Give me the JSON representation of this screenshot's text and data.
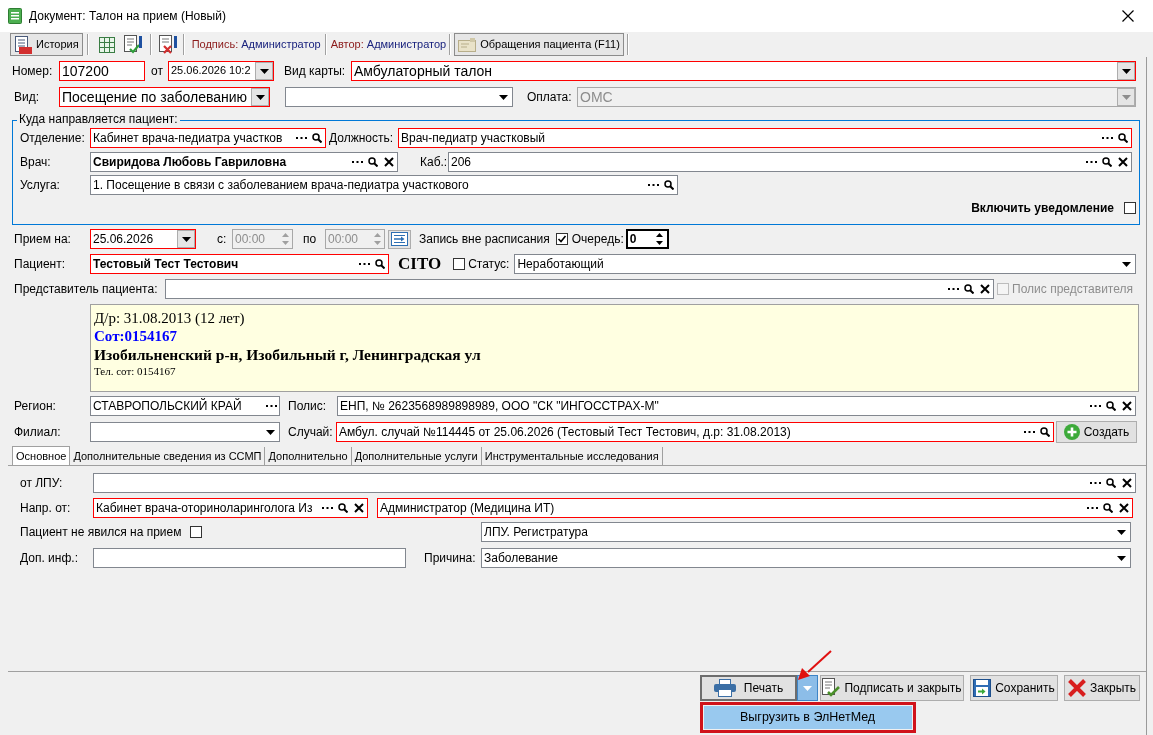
{
  "window": {
    "title": "Документ: Талон на прием (Новый)"
  },
  "toolbar": {
    "history_button": "История",
    "signed_by": {
      "label": "Подпись:",
      "value": "Администратор"
    },
    "author": {
      "label": "Автор:",
      "value": "Администратор"
    },
    "patient_appeals_button": "Обращения пациента (F11)"
  },
  "header": {
    "number": {
      "label": "Номер:",
      "value": "107200",
      "required": true
    },
    "date": {
      "label": "от",
      "value": "25.06.2026 10:2",
      "required": true
    },
    "card_type": {
      "label": "Вид карты:",
      "value": "Амбулаторный талон",
      "required": true
    },
    "visit_type": {
      "label": "Вид:",
      "value": "Посещение по заболеванию",
      "required": true
    },
    "visit_subtype": {
      "required": false
    },
    "payment": {
      "label": "Оплата:",
      "value": "ОМС",
      "disabled": true
    }
  },
  "referral": {
    "title": "Куда направляется пациент:",
    "department": {
      "label": "Отделение:",
      "value": "Кабинет врача-педиатра участков",
      "required": true
    },
    "position": {
      "label": "Должность:",
      "value": "Врач-педиатр участковый",
      "required": true
    },
    "doctor": {
      "label": "Врач:",
      "value": "Свиридова Любовь Гавриловна",
      "required": false
    },
    "room": {
      "label": "Каб.:",
      "value": "206",
      "required": false
    },
    "service": {
      "label": "Услуга:",
      "value": "1. Посещение в связи с заболеванием врача-педиатра участкового",
      "required": false
    },
    "notification": {
      "label": "Включить уведомление",
      "checked": false
    }
  },
  "appointment": {
    "date": {
      "label": "Прием на:",
      "value": "25.06.2026",
      "required": true
    },
    "time_from": {
      "label": "с:",
      "value": "00:00",
      "disabled": true
    },
    "time_to": {
      "label": "по",
      "value": "00:00",
      "disabled": true
    },
    "off_schedule": {
      "label": "Запись вне расписания",
      "checked": true
    },
    "queue": {
      "label": "Очередь:",
      "value": "0",
      "focused": true
    }
  },
  "patient": {
    "name": {
      "label": "Пациент:",
      "value": "Тестовый Тест Тестович",
      "required": true
    },
    "cito": {
      "label": "CITO",
      "checked": false
    },
    "status": {
      "label": "Статус:",
      "value": "Неработающий",
      "required": false
    },
    "representative": {
      "label": "Представитель пациента:",
      "required": false
    },
    "representative_policy": {
      "label": "Полис представителя",
      "checked": false,
      "disabled": true
    },
    "info": [
      {
        "kind": "birth",
        "text": "Д/р: 31.08.2013 (12 лет)"
      },
      {
        "kind": "contact",
        "text": "Сот:0154167"
      },
      {
        "kind": "address",
        "text": "Изобильненский р-н, Изобильный г, Ленинградская ул"
      },
      {
        "kind": "note",
        "text": "Тел. сот: 0154167"
      }
    ],
    "region": {
      "label": "Регион:",
      "value": "СТАВРОПОЛЬСКИЙ КРАЙ",
      "required": false
    },
    "policy": {
      "label": "Полис:",
      "value": "ЕНП, № 2623568989898989, ООО \"СК \"ИНГОССТРАХ-М\"",
      "required": false
    },
    "branch": {
      "label": "Филиал:",
      "required": false
    },
    "case": {
      "label": "Случай:",
      "value": "Амбул. случай №114445 от 25.06.2026 (Тестовый Тест Тестович, д.р: 31.08.2013)",
      "required": true
    },
    "create_button": "Создать"
  },
  "tabs": [
    {
      "label": "Основное",
      "selected": true
    },
    {
      "label": "Дополнительные сведения из ССМП",
      "selected": false
    },
    {
      "label": "Дополнительно",
      "selected": false
    },
    {
      "label": "Дополнительные услуги",
      "selected": false
    },
    {
      "label": "Инструментальные исследования",
      "selected": false
    }
  ],
  "tab_content": {
    "from_lpu": {
      "label": "от ЛПУ:",
      "required": false
    },
    "referred_by": {
      "label": "Напр. от:",
      "department": {
        "value": "Кабинет врача-оториноларинголога Из",
        "required": true
      },
      "person": {
        "value": "Администратор (Медицина ИТ)",
        "required": true
      }
    },
    "no_show": {
      "label": "Пациент не явился на прием",
      "checked": false
    },
    "registry": {
      "value": "ЛПУ. Регистратура",
      "required": false
    },
    "extra_info": {
      "label": "Доп. инф.:",
      "required": false
    },
    "reason": {
      "label": "Причина:",
      "value": "Заболевание",
      "required": false
    }
  },
  "footer": {
    "print_button": {
      "label": "Печать",
      "menu_open": true
    },
    "print_menu": [
      {
        "label": "Выгрузить в ЭлНетМед",
        "selected": true
      }
    ],
    "buttons": [
      {
        "kind": "sign",
        "label": "Подписать и закрыть"
      },
      {
        "kind": "save",
        "label": "Сохранить"
      },
      {
        "kind": "close",
        "label": "Закрыть"
      }
    ]
  }
}
